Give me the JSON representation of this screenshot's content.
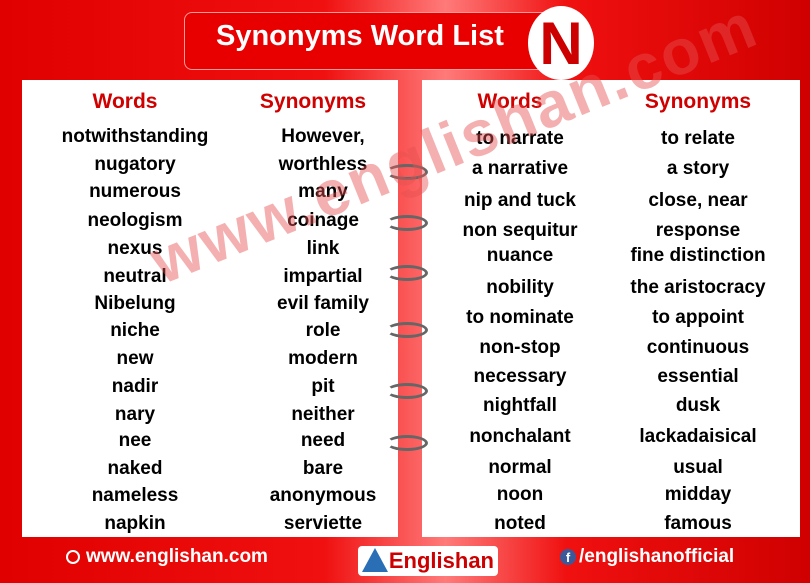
{
  "title": "Synonyms Word List",
  "letter": "N",
  "headers": {
    "words": "Words",
    "synonyms": "Synonyms"
  },
  "left": [
    [
      "notwithstanding",
      "However,"
    ],
    [
      "nugatory",
      "worthless"
    ],
    [
      "numerous",
      "many"
    ],
    [
      "neologism",
      "coinage"
    ],
    [
      "nexus",
      "link"
    ],
    [
      "neutral",
      "impartial"
    ],
    [
      "Nibelung",
      "evil family"
    ],
    [
      "niche",
      "role"
    ],
    [
      "new",
      "modern"
    ],
    [
      "nadir",
      "pit"
    ],
    [
      "nary",
      "neither"
    ],
    [
      "nee",
      "need"
    ],
    [
      "naked",
      "bare"
    ],
    [
      "nameless",
      "anonymous"
    ],
    [
      "napkin",
      "serviette"
    ]
  ],
  "right": [
    [
      "to narrate",
      "to relate"
    ],
    [
      "a narrative",
      "a story"
    ],
    [
      "nip and tuck",
      "close, near"
    ],
    [
      "non sequitur",
      "response"
    ],
    [
      "nuance",
      "fine distinction"
    ],
    [
      "nobility",
      "the aristocracy"
    ],
    [
      "to nominate",
      "to appoint"
    ],
    [
      "non-stop",
      "continuous"
    ],
    [
      "necessary",
      "essential"
    ],
    [
      "nightfall",
      "dusk"
    ],
    [
      "nonchalant",
      "lackadaisical"
    ],
    [
      "normal",
      "usual"
    ],
    [
      "noon",
      "midday"
    ],
    [
      "noted",
      "famous"
    ]
  ],
  "watermark": "www.englishan.com",
  "footer": {
    "website": "www.englishan.com",
    "brand": "Englishan",
    "facebook": "/englishanofficial"
  },
  "colors": {
    "accent": "#d00000",
    "background": "#e00000"
  }
}
